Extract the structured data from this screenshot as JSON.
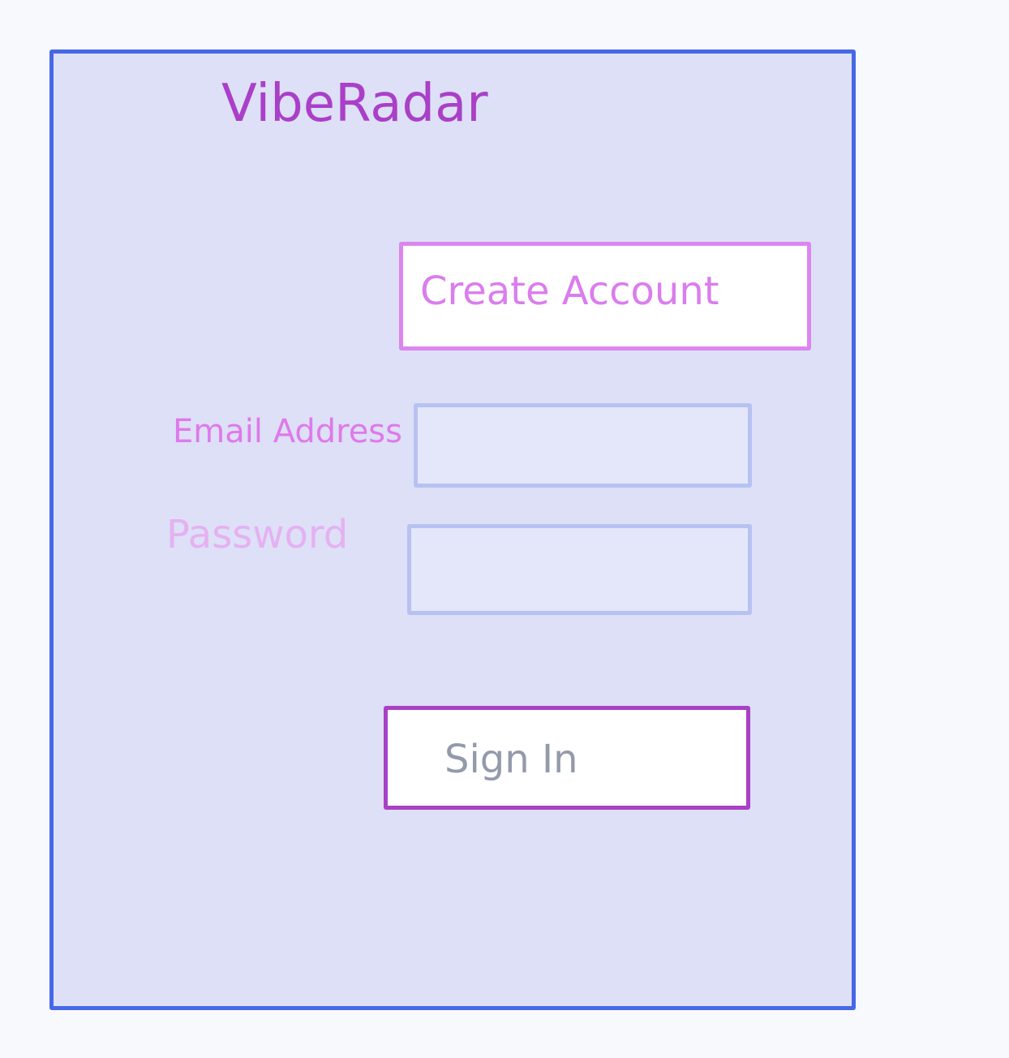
{
  "app": {
    "title": "VibeRadar"
  },
  "auth": {
    "create_account_label": "Create Account",
    "email": {
      "label": "Email Address",
      "value": "",
      "placeholder": ""
    },
    "password": {
      "label": "Password",
      "value": "",
      "placeholder": ""
    },
    "sign_in_label": "Sign In"
  },
  "colors": {
    "page_background": "#f8f9fc",
    "panel_background": "#dde0f6",
    "panel_border": "#4768e6",
    "title": "#aa3fc8",
    "create_account_border": "#dd85ef",
    "create_account_text": "#da7ded",
    "email_label": "#df79ea",
    "password_label": "#e5b1f2",
    "input_background": "#e3e7f9",
    "input_border": "#b7c2f1",
    "sign_in_border": "#a940c5",
    "sign_in_text": "#939aaa"
  }
}
